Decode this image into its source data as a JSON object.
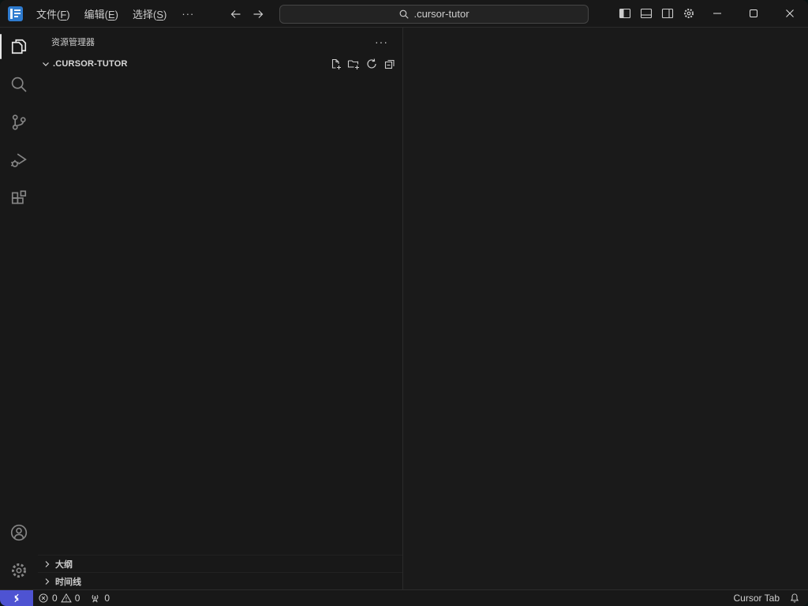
{
  "titlebar": {
    "menus": [
      {
        "pre": "文件(",
        "key": "F",
        "post": ")"
      },
      {
        "pre": "编辑(",
        "key": "E",
        "post": ")"
      },
      {
        "pre": "选择(",
        "key": "S",
        "post": ")"
      }
    ],
    "more_label": "···",
    "search": {
      "value": ".cursor-tutor"
    }
  },
  "sidebar": {
    "title": "资源管理器",
    "more_label": "···",
    "folder_name": ".CURSOR-TUTOR",
    "sections": [
      {
        "label": "大纲"
      },
      {
        "label": "时间线"
      }
    ]
  },
  "statusbar": {
    "error_count": "0",
    "warning_count": "0",
    "ports_count": "0",
    "cursor_tab_label": "Cursor Tab"
  },
  "colors": {
    "remote_bg": "#4e53d2",
    "app_icon": "#2e7bcf",
    "titlebar_bg": "#181818",
    "sidebar_bg": "#181818",
    "editor_bg": "#1a1a1a",
    "statusbar_bg": "#181818",
    "border": "#2b2b2b",
    "text": "#cccccc"
  }
}
